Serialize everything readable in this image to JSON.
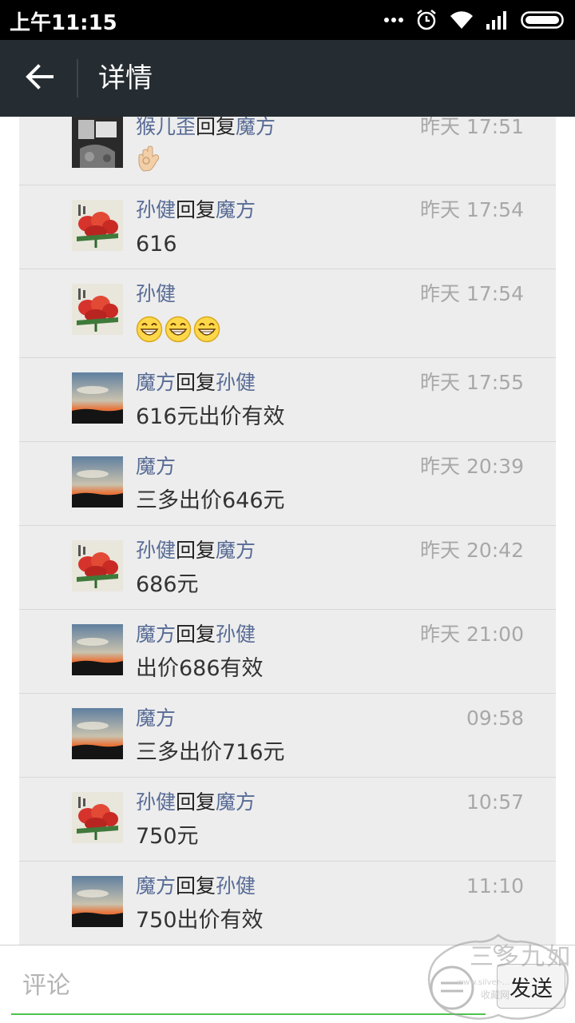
{
  "status_bar": {
    "time": "上午11:15",
    "icons": [
      "more-dots-icon",
      "alarm-icon",
      "wifi-icon",
      "signal-icon",
      "battery-icon"
    ]
  },
  "header": {
    "title": "详情",
    "back_icon": "back-arrow-icon",
    "background": "#262d32"
  },
  "comments": [
    {
      "author": "猴儿歪",
      "reply_word": "回复",
      "reply_to": "魔方",
      "time": "昨天 17:51",
      "text": "",
      "emoji": [
        "ok-hand"
      ],
      "avatar": "photo"
    },
    {
      "author": "孙健",
      "reply_word": "回复",
      "reply_to": "魔方",
      "time": "昨天 17:54",
      "text": "616",
      "emoji": [],
      "avatar": "flowers"
    },
    {
      "author": "孙健",
      "reply_word": "",
      "reply_to": "",
      "time": "昨天 17:54",
      "text": "",
      "emoji": [
        "grin",
        "grin",
        "grin"
      ],
      "avatar": "flowers"
    },
    {
      "author": "魔方",
      "reply_word": "回复",
      "reply_to": "孙健",
      "time": "昨天 17:55",
      "text": "616元出价有效",
      "emoji": [],
      "avatar": "sunset"
    },
    {
      "author": "魔方",
      "reply_word": "",
      "reply_to": "",
      "time": "昨天 20:39",
      "text": "三多出价646元",
      "emoji": [],
      "avatar": "sunset"
    },
    {
      "author": "孙健",
      "reply_word": "回复",
      "reply_to": "魔方",
      "time": "昨天 20:42",
      "text": "686元",
      "emoji": [],
      "avatar": "flowers"
    },
    {
      "author": "魔方",
      "reply_word": "回复",
      "reply_to": "孙健",
      "time": "昨天 21:00",
      "text": "出价686有效",
      "emoji": [],
      "avatar": "sunset"
    },
    {
      "author": "魔方",
      "reply_word": "",
      "reply_to": "",
      "time": "09:58",
      "text": "三多出价716元",
      "emoji": [],
      "avatar": "sunset"
    },
    {
      "author": "孙健",
      "reply_word": "回复",
      "reply_to": "魔方",
      "time": "10:57",
      "text": "750元",
      "emoji": [],
      "avatar": "flowers"
    },
    {
      "author": "魔方",
      "reply_word": "回复",
      "reply_to": "孙健",
      "time": "11:10",
      "text": "750出价有效",
      "emoji": [],
      "avatar": "sunset"
    }
  ],
  "input_bar": {
    "placeholder": "评论",
    "send_label": "发送",
    "underline_color": "#4ec24e"
  },
  "watermark": {
    "main": "三多九如",
    "url": "www.silver-...",
    "sub": "收藏网"
  },
  "colors": {
    "name_link": "#576b95",
    "time_gray": "#a8a8a8",
    "list_background": "#ededed"
  }
}
